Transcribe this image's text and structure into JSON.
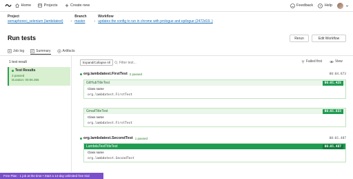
{
  "nav": {
    "home": "Home",
    "projects": "Projects",
    "create_new": "Create new",
    "feedback": "Feedback",
    "help": "Help"
  },
  "context": {
    "project_label": "Project",
    "project_value": "semaphoreci_selenium (lambdatest)",
    "branch_label": "Branch",
    "branch_value": "master",
    "workflow_label": "Workflow",
    "workflow_value": "updates the config to run in chrome with prologue and epilogue (2472d19..)"
  },
  "page": {
    "title": "Run tests",
    "rerun": "Rerun",
    "edit_workflow": "Edit Workflow"
  },
  "tabs": [
    {
      "label": "Job log",
      "icon": "joblog-icon"
    },
    {
      "label": "Summary",
      "icon": "summary-icon"
    },
    {
      "label": "Artifacts",
      "icon": "artifacts-icon"
    }
  ],
  "left": {
    "count": "1 test result",
    "result_title": "Test Results",
    "result_status": "3 passed",
    "result_duration": "Duration: 00:06.355"
  },
  "filters": {
    "expand": "Expand/Collapse All",
    "filter_placeholder": "Filter test...",
    "failed": "Failed first",
    "view": "View"
  },
  "groups": [
    {
      "name": "org.lambdatest.FirstTest",
      "status": "2 passed",
      "time": "00:04.873",
      "cases": [
        {
          "name": "GitHubTitleTest",
          "time": "00:01.425",
          "class_label": "Class name",
          "class_value": "org.lambdatest.FirstTest"
        },
        {
          "name": "GmailTitleTest",
          "time": "00:01.833",
          "class_label": "Class name",
          "class_value": "org.lambdatest.FirstTest"
        }
      ]
    },
    {
      "name": "org.lambdatest.SecondTest",
      "status": "1 passed",
      "time": "00:01.487",
      "cases": [
        {
          "name": "LambdaTestTitleTest",
          "time": "00:01.487",
          "class_label": "Class name",
          "class_value": "org.lambdatest.SecondTest"
        }
      ]
    }
  ],
  "banner": "Free Plan · 1 job at the time • Start a 14-day unlimited free trial",
  "colors": {
    "accent_green": "#1f9b52",
    "link_blue": "#1a6fb5",
    "banner_purple": "#7b4fc9"
  }
}
